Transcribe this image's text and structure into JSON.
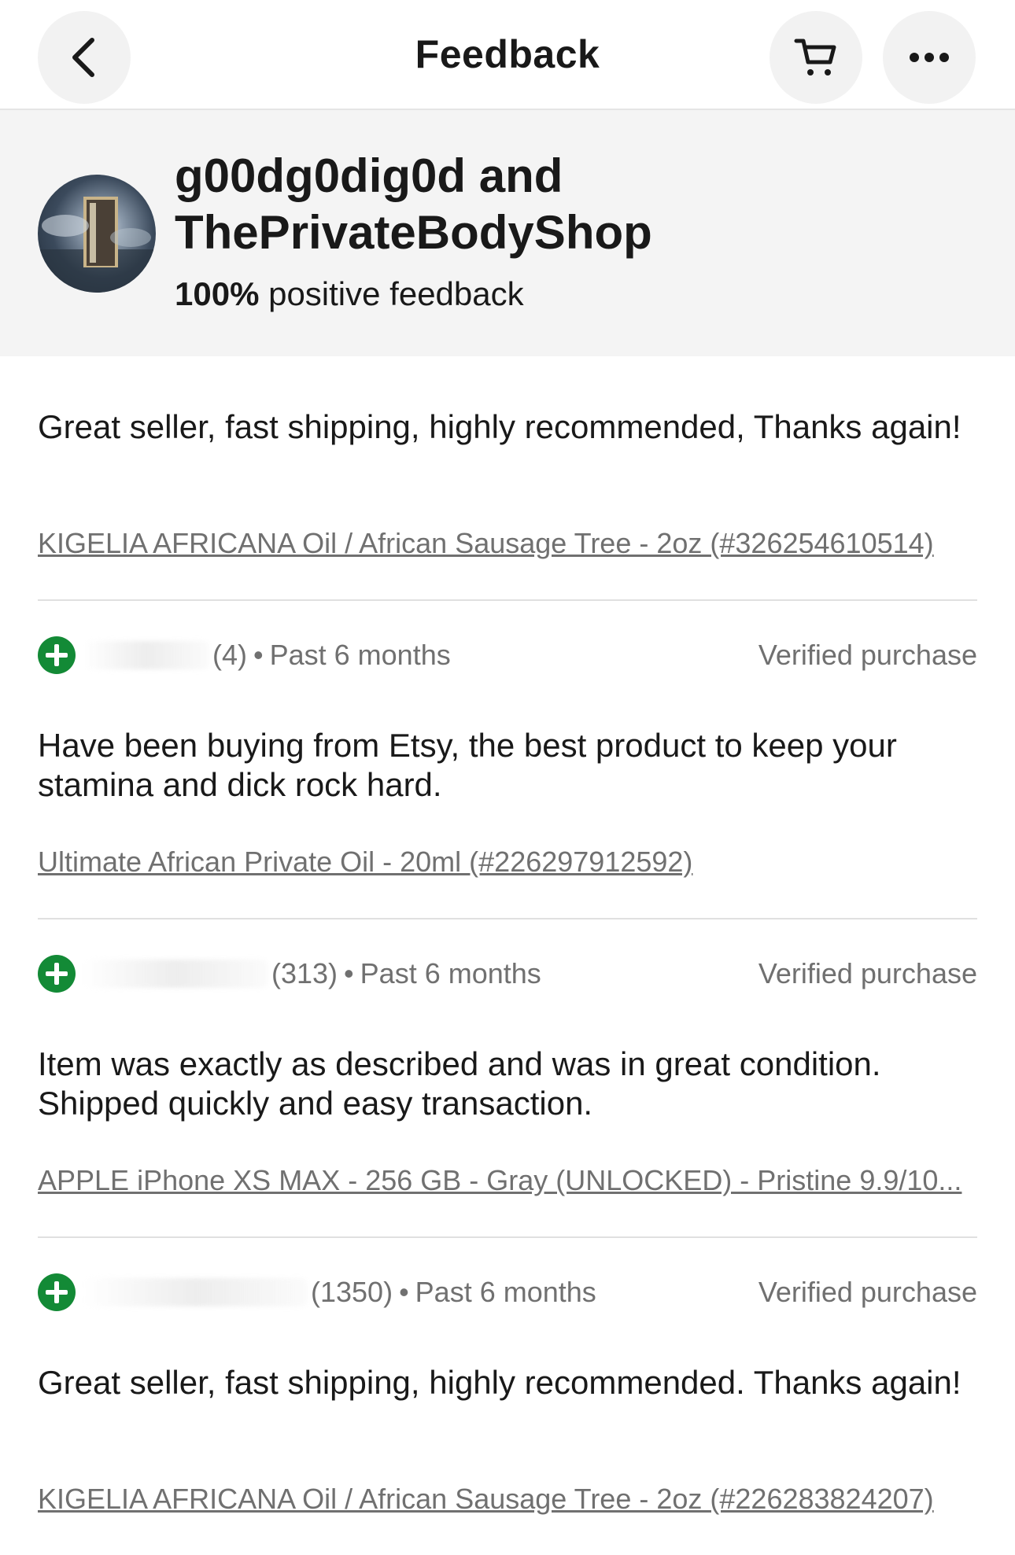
{
  "nav": {
    "title": "Feedback",
    "back_icon": "chevron-left-icon",
    "cart_icon": "cart-icon",
    "more_icon": "more-horizontal-icon"
  },
  "seller": {
    "name_line1": "g00dg0dig0d and",
    "name_line2": "ThePrivateBodyShop",
    "positive_percent": "100%",
    "positive_label": "positive feedback"
  },
  "feedback": [
    {
      "comment": "Great seller, fast shipping, highly recommended, Thanks again!",
      "item": "KIGELIA AFRICANA Oil / African Sausage Tree - 2oz (#326254610514)"
    },
    {
      "score": "(4)",
      "time": "Past 6 months",
      "verified": "Verified purchase",
      "comment": "Have been buying from Etsy, the best product to keep your stamina and dick rock hard.",
      "item": "Ultimate African Private Oil - 20ml (#226297912592)"
    },
    {
      "score": "(313)",
      "time": "Past 6 months",
      "verified": "Verified purchase",
      "comment": "Item was exactly as described and was in great condition. Shipped quickly and easy transaction.",
      "item": "APPLE iPhone XS MAX - 256 GB - Gray (UNLOCKED) - Pristine 9.9/10..."
    },
    {
      "score": "(1350)",
      "time": "Past 6 months",
      "verified": "Verified purchase",
      "comment": "Great seller, fast shipping, highly recommended. Thanks again!",
      "item": "KIGELIA AFRICANA Oil / African Sausage Tree - 2oz (#226283824207)"
    }
  ],
  "separator": "•",
  "colors": {
    "positive_icon": "#138a36",
    "secondary_text": "#707070",
    "header_bg": "#f4f4f4"
  }
}
